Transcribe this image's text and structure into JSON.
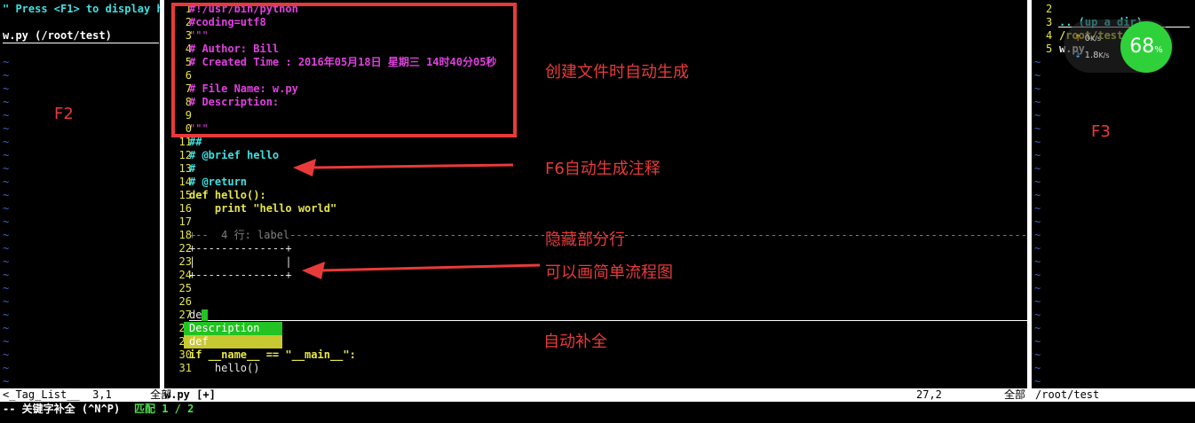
{
  "left_pane": {
    "help_hint": "\" Press <F1> to display h",
    "file_entry": "w.py (/root/test)",
    "tilde": "~"
  },
  "editor": {
    "lines": [
      {
        "num": "1",
        "text": "#!/usr/bin/python",
        "style": "c-comment"
      },
      {
        "num": "2",
        "text": "#coding=utf8",
        "style": "c-comment"
      },
      {
        "num": "3",
        "text": "\"\"\"",
        "style": "c-str"
      },
      {
        "num": "4",
        "text": "# Author: Bill",
        "style": "c-comment"
      },
      {
        "num": "5",
        "text": "# Created Time : 2016年05月18日 星期三 14时40分05秒",
        "style": "c-comment"
      },
      {
        "num": "6",
        "text": "",
        "style": "c-comment"
      },
      {
        "num": "7",
        "text": "# File Name: w.py",
        "style": "c-comment"
      },
      {
        "num": "8",
        "text": "# Description:",
        "style": "c-comment"
      },
      {
        "num": "9",
        "text": "",
        "style": "c-comment"
      },
      {
        "num": "0",
        "text": "\"\"\"",
        "style": "c-str"
      },
      {
        "num": "11",
        "text": "##",
        "style": "c-cyan"
      },
      {
        "num": "12",
        "text": "# @brief hello",
        "style": "c-cyan"
      },
      {
        "num": "13",
        "text": "#",
        "style": "c-cyan"
      },
      {
        "num": "14",
        "text": "# @return",
        "style": "c-cyan"
      },
      {
        "num": "15",
        "text": "def hello():",
        "style": "c-kw"
      },
      {
        "num": "16",
        "text": "    print \"hello world\"",
        "style": "c-kw"
      },
      {
        "num": "17",
        "text": "",
        "style": "c-normal"
      },
      {
        "num": "18",
        "text": "+--  4 行: label-----------------------------------------------------------------------------------------------------------------------",
        "style": "c-fold"
      },
      {
        "num": "22",
        "text": "+--------------+",
        "style": "c-normal"
      },
      {
        "num": "23",
        "text": "|              |",
        "style": "c-normal"
      },
      {
        "num": "24",
        "text": "+--------------+",
        "style": "c-normal"
      },
      {
        "num": "25",
        "text": "",
        "style": "c-normal"
      },
      {
        "num": "26",
        "text": "",
        "style": "c-normal"
      },
      {
        "num": "27",
        "text": "de",
        "style": "c-normal"
      },
      {
        "num": "28",
        "text": "",
        "style": "c-normal"
      },
      {
        "num": "29",
        "text": "",
        "style": "c-normal"
      },
      {
        "num": "30",
        "text": "if __name__ == \"__main__\":",
        "style": "c-kw"
      },
      {
        "num": "31",
        "text": "    hello()",
        "style": "c-normal"
      }
    ],
    "popup": [
      {
        "label": "Description",
        "bg": "#22c322",
        "fg": "#ffffff"
      },
      {
        "label": "def",
        "bg": "#c8c832",
        "fg": "#ffffff"
      }
    ]
  },
  "right_pane": {
    "lines": [
      {
        "num": "2",
        "text": ""
      },
      {
        "num": "3",
        "text": ".. (up a dir)"
      },
      {
        "num": "4",
        "text": "/root/test/"
      },
      {
        "num": "5",
        "text": "w.py"
      }
    ]
  },
  "widget": {
    "percent": "68",
    "percent_sign": "%",
    "up_speed": "0",
    "up_unit": "K/s",
    "down_speed": "1.8",
    "down_unit": "K/s"
  },
  "status": {
    "left": "<_Tag_List__  3,1      全部",
    "file": "w.py [+]",
    "pos": "27,2",
    "all": "全部",
    "dir": "/root/test"
  },
  "cmdline": {
    "mode": "-- 关键字补全 (^N^P)",
    "match": "匹配 1 / 2"
  },
  "annotations": {
    "f2": "F2",
    "f3": "F3",
    "auto_header": "创建文件时自动生成",
    "f6": "F6自动生成注释",
    "hide": "隐藏部分行",
    "flow": "可以画简单流程图",
    "complete": "自动补全"
  },
  "colors": {
    "annotation_red": "#e83a3a",
    "line_number": "#e6e64c",
    "comment_magenta": "#e040e0",
    "doc_cyan": "#40e0e0",
    "tilde_blue": "#3a64c8",
    "battery_green": "#2fd13a"
  }
}
